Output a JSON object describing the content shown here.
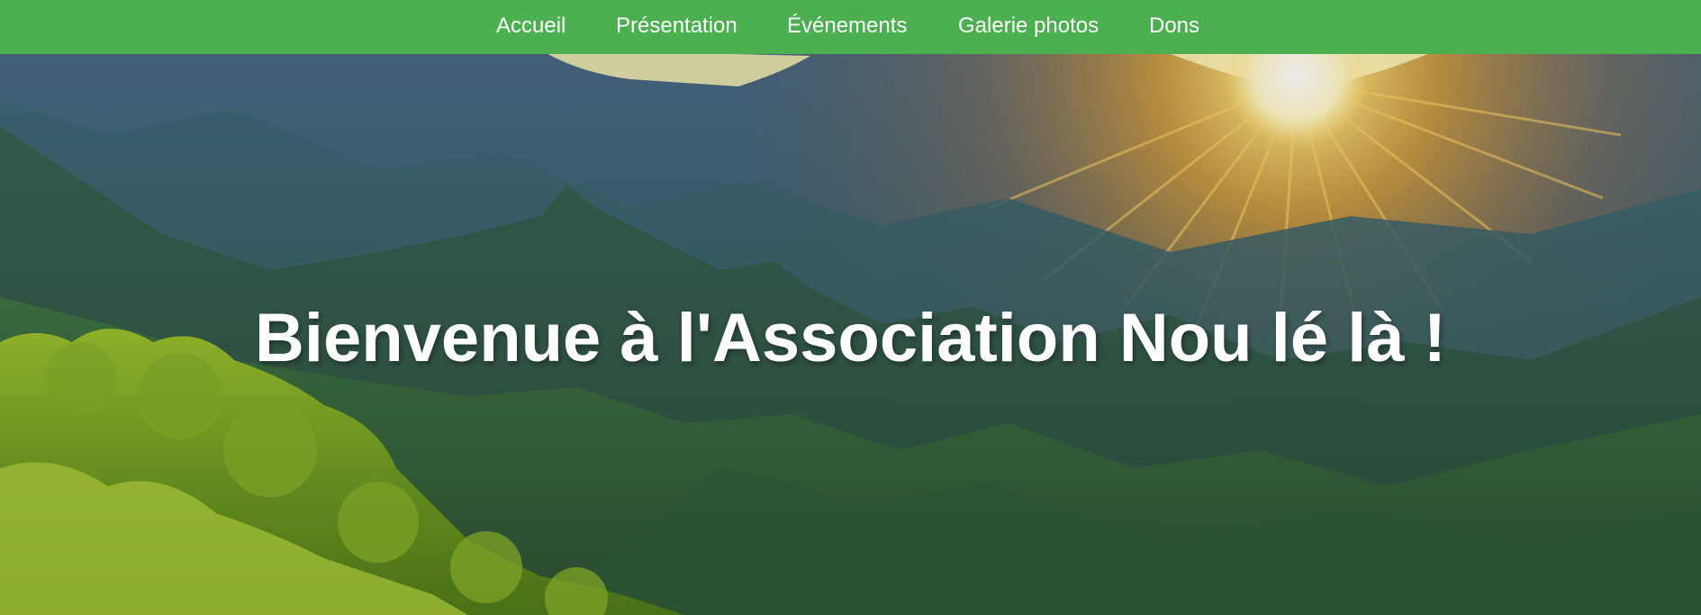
{
  "nav": {
    "items": [
      {
        "label": "Accueil"
      },
      {
        "label": "Présentation"
      },
      {
        "label": "Événements"
      },
      {
        "label": "Galerie photos"
      },
      {
        "label": "Dons"
      }
    ],
    "background": "#4caf50",
    "text_color": "#ffffff"
  },
  "hero": {
    "title": "Bienvenue à l'Association Nou lé là !",
    "title_color": "#ffffff",
    "image": "mountain-sunset-landscape"
  }
}
